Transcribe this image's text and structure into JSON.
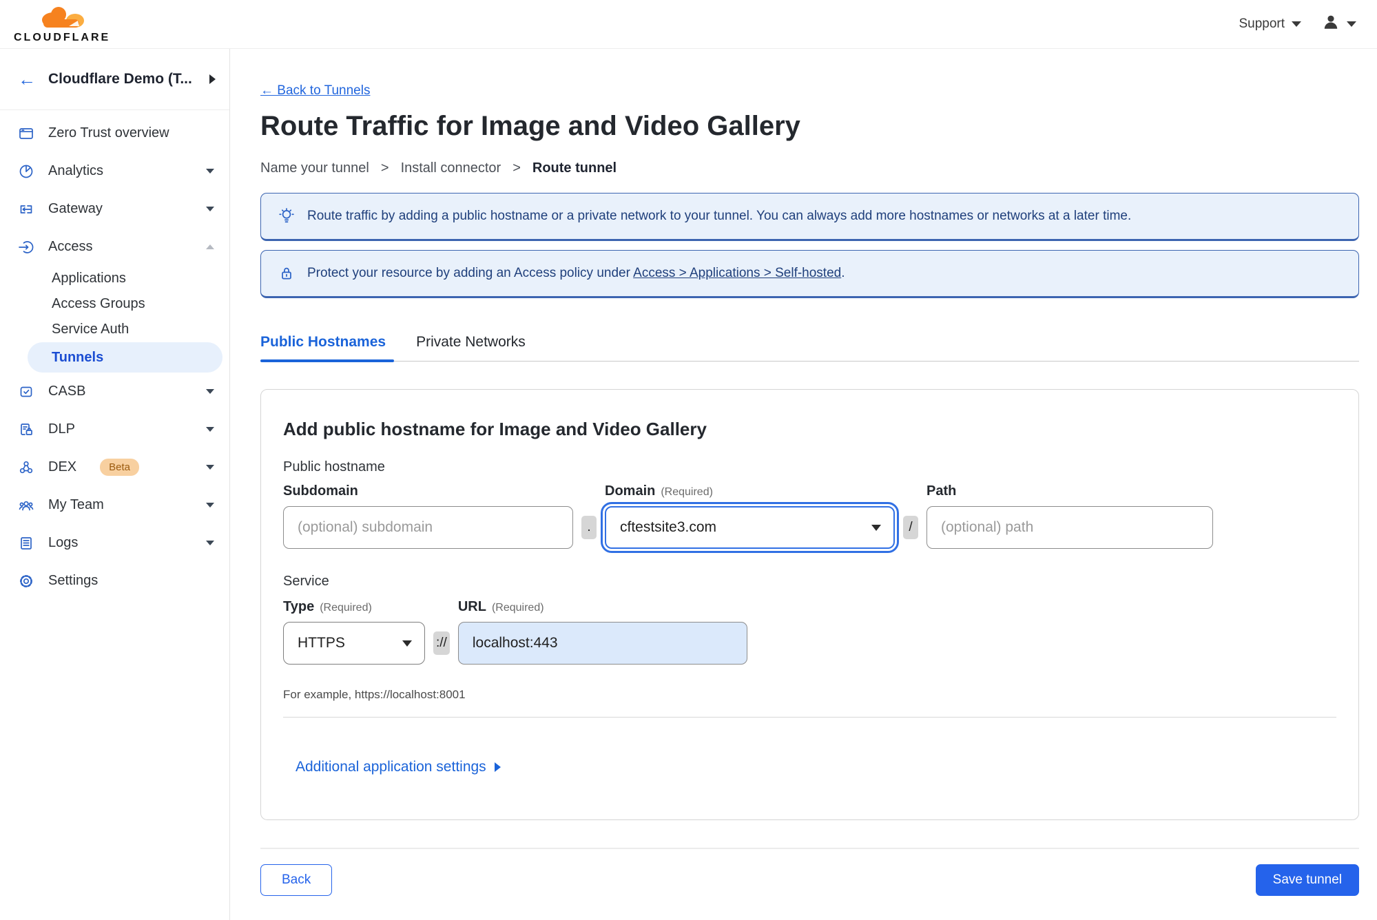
{
  "topbar": {
    "support_label": "Support"
  },
  "sidebar": {
    "account_name": "Cloudflare Demo (T...",
    "logo_text": "CLOUDFLARE",
    "items": [
      {
        "label": "Zero Trust overview",
        "icon": "window-icon"
      },
      {
        "label": "Analytics",
        "icon": "pie-chart-icon"
      },
      {
        "label": "Gateway",
        "icon": "gateway-icon"
      },
      {
        "label": "Access",
        "icon": "access-icon",
        "expanded": true
      },
      {
        "label": "CASB",
        "icon": "check-square-icon"
      },
      {
        "label": "DLP",
        "icon": "document-lock-icon"
      },
      {
        "label": "DEX",
        "icon": "nodes-icon",
        "badge": "Beta"
      },
      {
        "label": "My Team",
        "icon": "people-icon"
      },
      {
        "label": "Logs",
        "icon": "list-icon"
      },
      {
        "label": "Settings",
        "icon": "gear-icon"
      }
    ],
    "access_subitems": [
      {
        "label": "Applications"
      },
      {
        "label": "Access Groups"
      },
      {
        "label": "Service Auth"
      },
      {
        "label": "Tunnels",
        "active": true
      }
    ]
  },
  "main": {
    "back_link": "← Back to Tunnels",
    "title": "Route Traffic for Image and Video Gallery",
    "steps": [
      "Name your tunnel",
      "Install connector",
      "Route tunnel"
    ],
    "step_separator": ">",
    "banners": [
      {
        "icon": "lightbulb-icon",
        "text": "Route traffic by adding a public hostname or a private network to your tunnel. You can always add more hostnames or networks at a later time."
      },
      {
        "icon": "lock-icon",
        "text_prefix": "Protect your resource by adding an Access policy under ",
        "link": "Access > Applications > Self-hosted",
        "text_suffix": "."
      }
    ],
    "tabs": [
      {
        "label": "Public Hostnames",
        "active": true
      },
      {
        "label": "Private Networks",
        "active": false
      }
    ],
    "form": {
      "heading": "Add public hostname for Image and Video Gallery",
      "public_hostname_label": "Public hostname",
      "subdomain_label": "Subdomain",
      "subdomain_placeholder": "(optional) subdomain",
      "dot_separator": ".",
      "domain_label": "Domain",
      "required_note": "(Required)",
      "domain_value": "cftestsite3.com",
      "slash_separator": "/",
      "path_label": "Path",
      "path_placeholder": "(optional) path",
      "service_label": "Service",
      "type_label": "Type",
      "type_value": "HTTPS",
      "scheme_separator": "://",
      "url_label": "URL",
      "url_value": "localhost:443",
      "url_example": "For example, https://localhost:8001",
      "additional_settings_label": "Additional application settings"
    },
    "footer": {
      "back_label": "Back",
      "save_label": "Save tunnel"
    }
  },
  "colors": {
    "accent_blue": "#2563eb",
    "link_blue": "#2266dd",
    "tab_active_blue": "#1a63d9",
    "banner_background": "#e9f1fb",
    "banner_border": "#3c64b0",
    "banner_text": "#20407c",
    "active_nav_background": "#e7f0fc",
    "active_nav_text": "#1b4dd2",
    "beta_badge_background": "#f8d0a0",
    "beta_badge_text": "#9c5c10",
    "brand_orange": "#f6821f",
    "brand_orange_light": "#fbad41",
    "url_input_background": "#dbe9fb"
  }
}
